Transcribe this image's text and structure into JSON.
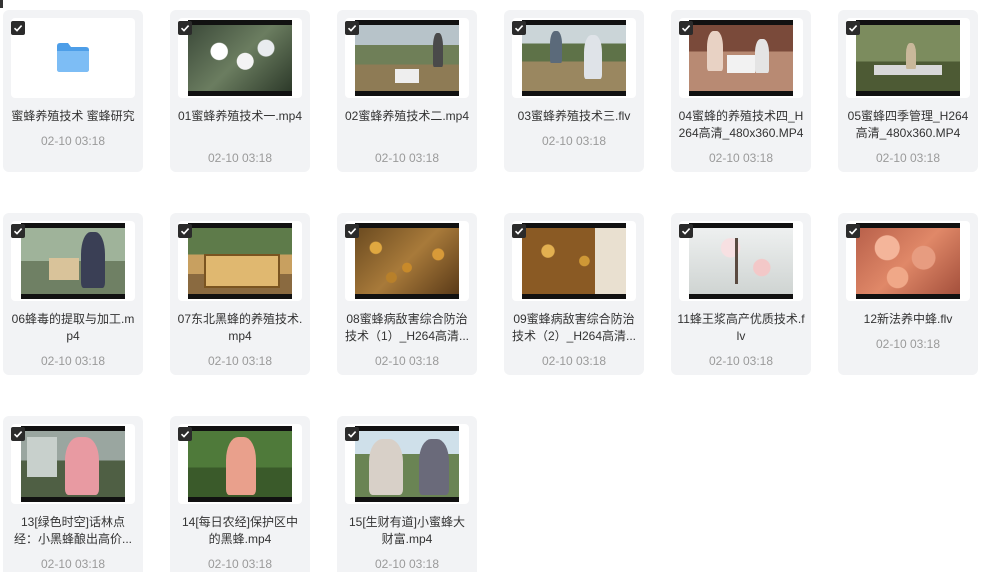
{
  "items": [
    {
      "name": "蜜蜂养殖技术 蜜蜂研究",
      "date": "02-10 03:18",
      "type": "folder"
    },
    {
      "name": "01蜜蜂养殖技术一.mp4",
      "date": "02-10 03:18",
      "type": "video"
    },
    {
      "name": "02蜜蜂养殖技术二.mp4",
      "date": "02-10 03:18",
      "type": "video"
    },
    {
      "name": "03蜜蜂养殖技术三.flv",
      "date": "02-10 03:18",
      "type": "video"
    },
    {
      "name": "04蜜蜂的养殖技术四_H264高清_480x360.MP4",
      "date": "02-10 03:18",
      "type": "video"
    },
    {
      "name": "05蜜蜂四季管理_H264高清_480x360.MP4",
      "date": "02-10 03:18",
      "type": "video"
    },
    {
      "name": "06蜂毒的提取与加工.mp4",
      "date": "02-10 03:18",
      "type": "video"
    },
    {
      "name": "07东北黑蜂的养殖技术.mp4",
      "date": "02-10 03:18",
      "type": "video"
    },
    {
      "name": "08蜜蜂病敌害综合防治技术（1）_H264高清...",
      "date": "02-10 03:18",
      "type": "video"
    },
    {
      "name": "09蜜蜂病敌害综合防治技术（2）_H264高清...",
      "date": "02-10 03:18",
      "type": "video"
    },
    {
      "name": "11蜂王浆高产优质技术.flv",
      "date": "02-10 03:18",
      "type": "video"
    },
    {
      "name": "12新法养中蜂.flv",
      "date": "02-10 03:18",
      "type": "video"
    },
    {
      "name": "13[绿色时空]话林点经：小黑蜂酿出高价...",
      "date": "02-10 03:18",
      "type": "video"
    },
    {
      "name": "14[每日农经]保护区中的黑蜂.mp4",
      "date": "02-10 03:18",
      "type": "video"
    },
    {
      "name": "15[生财有道]小蜜蜂大财富.mp4",
      "date": "02-10 03:18",
      "type": "video"
    }
  ],
  "colors": {
    "tile_bg": "#f2f3f5",
    "folder_blue": "#5aa9f0",
    "checkbox_bg": "#2b2b2b",
    "name_text": "#333333",
    "date_text": "#9a9a9a"
  },
  "icons": {
    "folder": "folder-icon",
    "checkbox": "checkbox-checked-icon"
  }
}
